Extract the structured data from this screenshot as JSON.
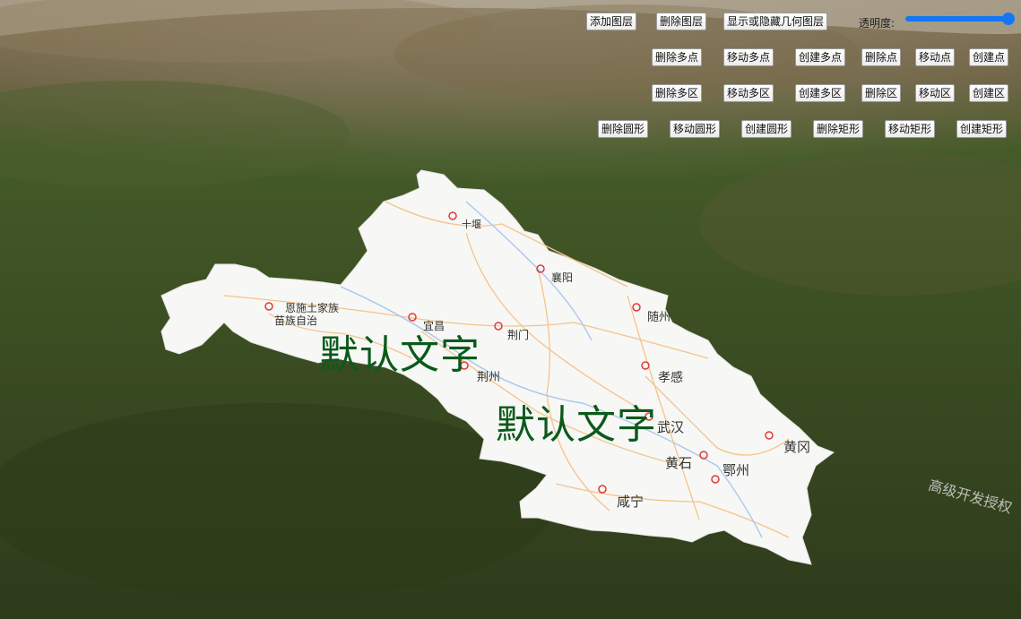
{
  "toolbar": {
    "row1": {
      "add_layer": "添加图层",
      "delete_layer": "删除图层",
      "toggle_geometry_layer": "显示或隐藏几何图层",
      "opacity_label": "透明度:",
      "opacity_value": 1.0
    },
    "row2": {
      "delete_multipoint": "删除多点",
      "move_multipoint": "移动多点",
      "create_multipoint": "创建多点",
      "delete_point": "删除点",
      "move_point": "移动点",
      "create_point": "创建点"
    },
    "row3": {
      "delete_multipolygon": "删除多区",
      "move_multipolygon": "移动多区",
      "create_multipolygon": "创建多区",
      "delete_polygon": "删除区",
      "move_polygon": "移动区",
      "create_polygon": "创建区"
    },
    "row4": {
      "delete_circle": "删除圆形",
      "move_circle": "移动圆形",
      "create_circle": "创建圆形",
      "delete_rect": "删除矩形",
      "move_rect": "移动矩形",
      "create_rect": "创建矩形"
    }
  },
  "map": {
    "cities": {
      "shiyan": "十堰",
      "xiangyang": "襄阳",
      "suizhou": "随州",
      "enshi": "恩施土家族",
      "enshi2": "苗族自治",
      "yichang": "宜昌",
      "jingmen": "荆门",
      "jingzhou": "荆州",
      "xiaogan": "孝感",
      "wuhan": "武汉",
      "huanggang": "黄冈",
      "huangshi": "黄石",
      "ezhou": "鄂州",
      "xianning": "咸宁"
    },
    "labels": {
      "label1": "默认文字",
      "label2": "默认文字"
    },
    "watermark": "高级开发授权"
  },
  "colors": {
    "accent": "#1476f5",
    "label_text": "#0b5a1c"
  }
}
